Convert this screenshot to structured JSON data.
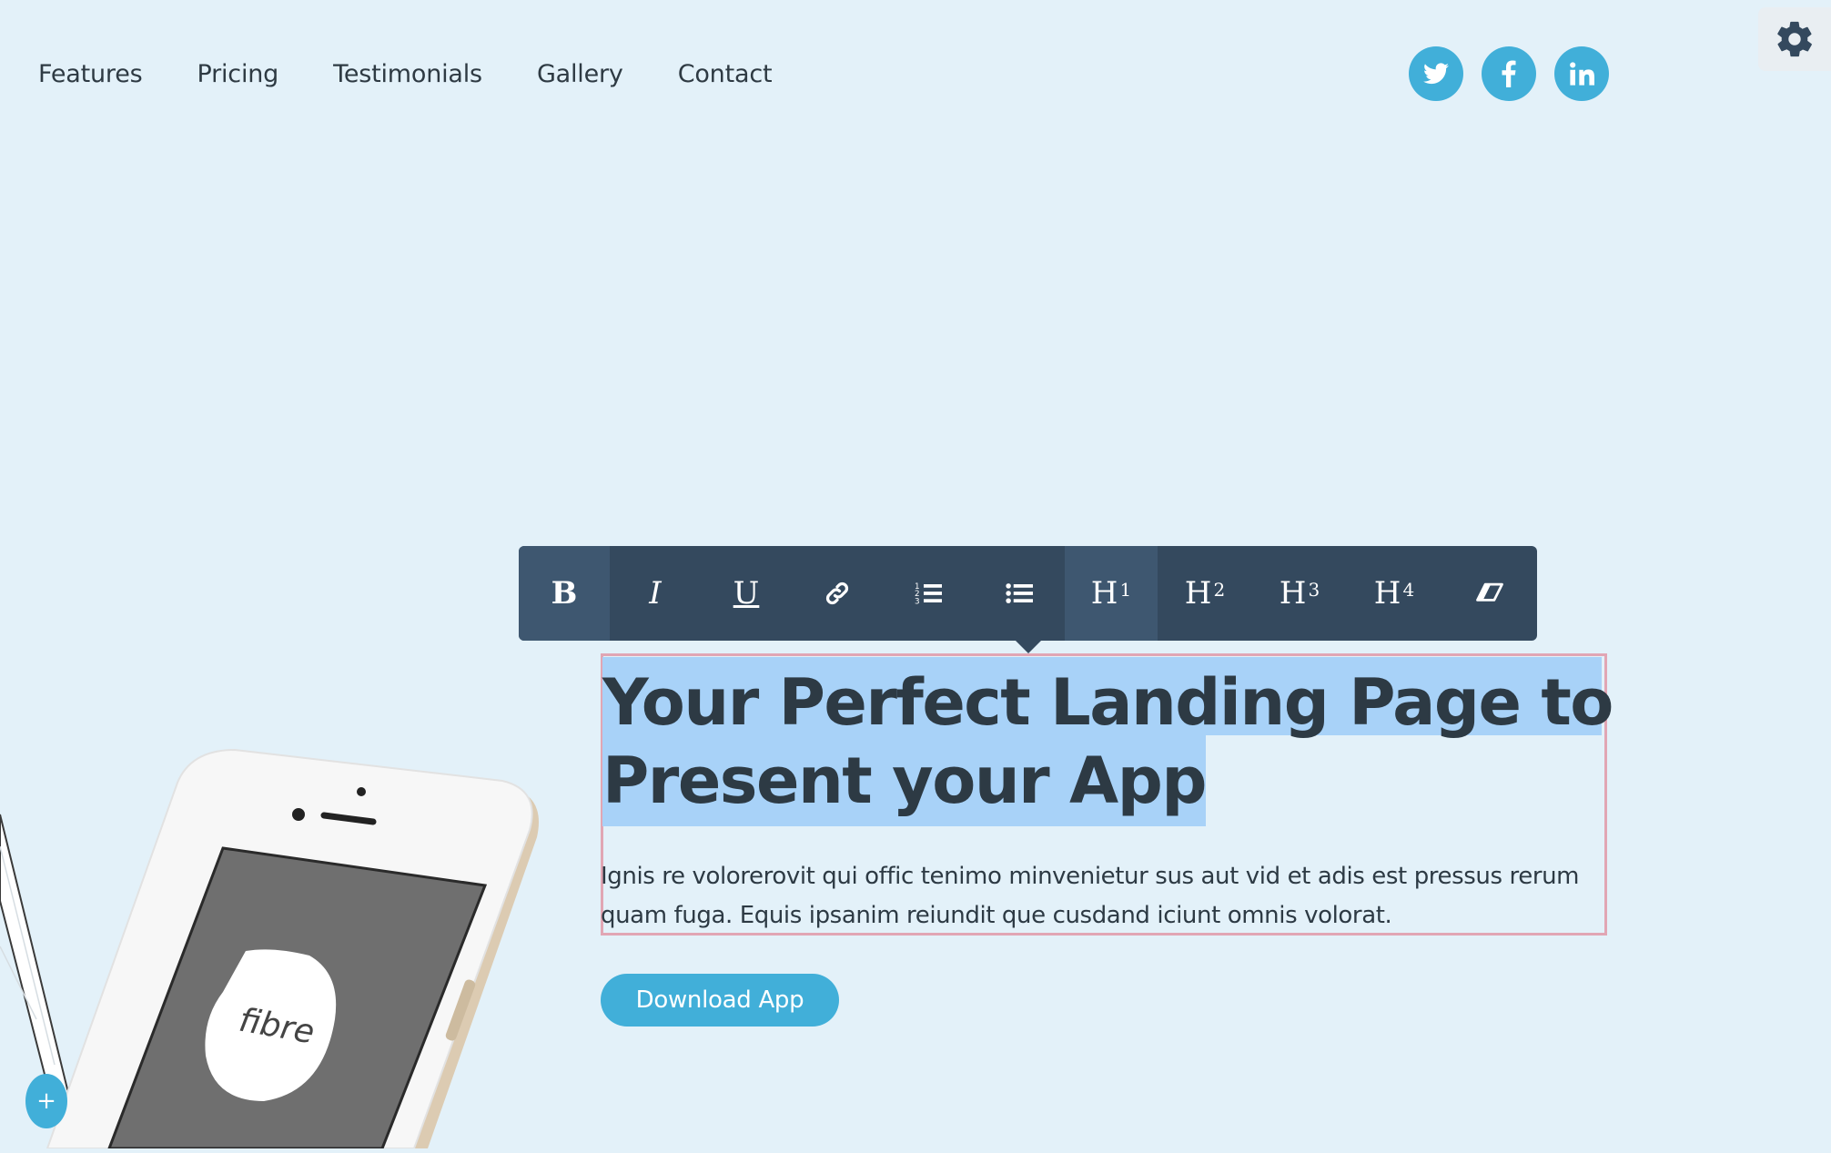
{
  "nav": {
    "items": [
      {
        "label": "Features"
      },
      {
        "label": "Pricing"
      },
      {
        "label": "Testimonials"
      },
      {
        "label": "Gallery"
      },
      {
        "label": "Contact"
      }
    ]
  },
  "social": {
    "icons": [
      "twitter-icon",
      "facebook-icon",
      "linkedin-icon"
    ],
    "color": "#41afd9"
  },
  "settings": {
    "icon": "gear-icon"
  },
  "toolbar": {
    "buttons": [
      {
        "name": "bold",
        "label": "B",
        "active": true
      },
      {
        "name": "italic",
        "label": "I",
        "active": false
      },
      {
        "name": "underline",
        "label": "U",
        "active": false
      },
      {
        "name": "link",
        "icon": "link-icon",
        "active": false
      },
      {
        "name": "ordered-list",
        "icon": "ordered-list-icon",
        "active": false
      },
      {
        "name": "unordered-list",
        "icon": "unordered-list-icon",
        "active": false
      },
      {
        "name": "h1",
        "label": "H",
        "sup": "1",
        "active": true
      },
      {
        "name": "h2",
        "label": "H",
        "sup": "2",
        "active": false
      },
      {
        "name": "h3",
        "label": "H",
        "sup": "3",
        "active": false
      },
      {
        "name": "h4",
        "label": "H",
        "sup": "4",
        "active": false
      },
      {
        "name": "clear-format",
        "icon": "eraser-icon",
        "active": false
      }
    ],
    "background": "#34495e",
    "active_background": "#3e5770"
  },
  "hero": {
    "headline_line1": "Your Perfect Landing Page to",
    "headline_line2": "Present your App",
    "lead": "Ignis re volorerovit qui offic tenimo minvenietur sus aut vid et adis est pressus rerum quam fuga. Equis ipsanim reiundit que cusdand iciunt omnis volorat.",
    "cta_label": "Download App",
    "selection_color": "#a8d2f8"
  },
  "phone": {
    "screen_label": "fibre"
  },
  "fab": {
    "label": "+"
  }
}
